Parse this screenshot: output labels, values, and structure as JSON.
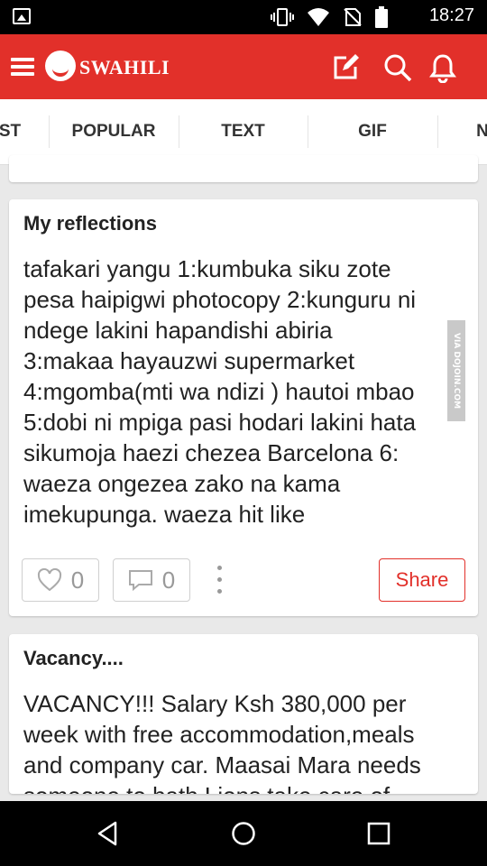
{
  "status_bar": {
    "time": "18:27",
    "icons": [
      "image-icon",
      "vibrate-icon",
      "wifi-icon",
      "no-sim-icon",
      "battery-icon"
    ]
  },
  "app_bar": {
    "brand": "SWAHILI",
    "icons": [
      "menu-icon",
      "logo-icon",
      "edit-icon",
      "search-icon",
      "bell-icon"
    ]
  },
  "tabs": [
    {
      "label": "ST",
      "active": false
    },
    {
      "label": "POPULAR",
      "active": false
    },
    {
      "label": "TEXT",
      "active": true
    },
    {
      "label": "GIF",
      "active": false
    },
    {
      "label": "N",
      "active": false
    }
  ],
  "posts": [
    {
      "title": "My reflections",
      "lines": [
        "tafakari yangu 1:kumbuka siku zote",
        "pesa haipigwi photocopy 2:kunguru ni",
        "ndege lakini hapandishi abiria",
        "3:makaa hayauzwi supermarket",
        "4:mgomba(mti wa ndizi ) hautoi mbao",
        "5:dobi ni mpiga pasi hodari lakini hata",
        "sikumoja haezi chezea Barcelona 6:",
        "waeza ongezea zako na kama",
        "imekupunga. waeza hit like"
      ],
      "likes": "0",
      "comments": "0",
      "share_label": "Share",
      "watermark": "VIA DOJOIN.COM"
    },
    {
      "title": "Vacancy....",
      "lines": [
        "VACANCY!!! Salary Ksh 380,000 per",
        "week with free accommodation,meals",
        "and company car. Maasai Mara needs",
        "someone to bath Lions take care of"
      ]
    }
  ],
  "colors": {
    "accent": "#e2302a",
    "background": "#e9e9e9"
  }
}
